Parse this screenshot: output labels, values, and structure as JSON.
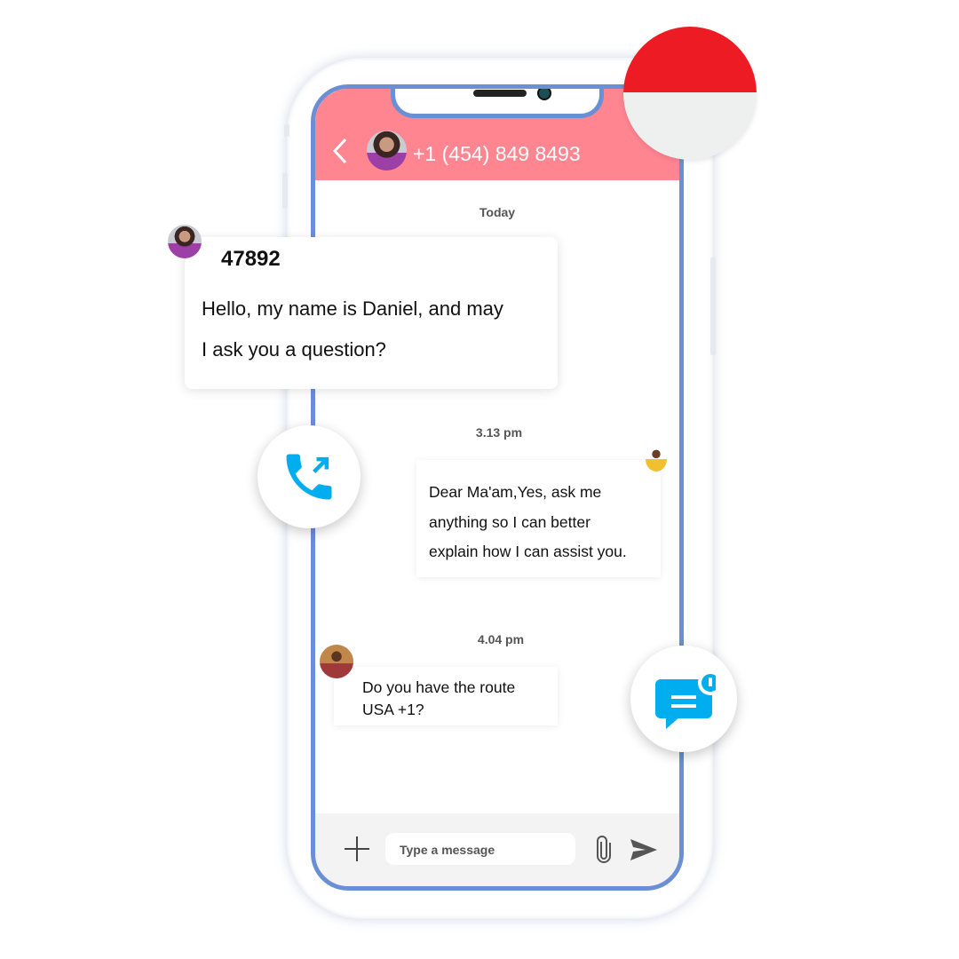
{
  "header": {
    "contact_number": "+1 (454) 849 8493",
    "back_icon": "chevron-left-icon"
  },
  "chat": {
    "date_label": "Today",
    "messages": [
      {
        "sender": "47892",
        "lines": [
          "Hello, my name is Daniel, and may",
          "I ask you a question?"
        ]
      },
      {
        "time": "3.13 pm",
        "lines": [
          "Dear Ma'am,Yes, ask me",
          "anything so I can better",
          "explain how I can assist you."
        ]
      },
      {
        "time": "4.04 pm",
        "lines": [
          "Do you have the route",
          "USA +1?"
        ]
      }
    ]
  },
  "composer": {
    "placeholder": "Type a message",
    "add_icon": "plus-icon",
    "attach_icon": "paperclip-icon",
    "send_icon": "send-icon"
  },
  "floating": {
    "call_icon": "phone-outgoing-icon",
    "chat_icon": "chat-notification-icon",
    "flag": "indonesia-flag"
  },
  "colors": {
    "header": "#ff8591",
    "frame": "#6b8fd5",
    "accent": "#00aeef",
    "flag_red": "#ed1c24"
  }
}
